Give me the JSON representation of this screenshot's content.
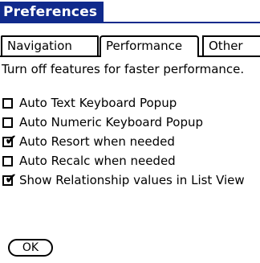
{
  "window": {
    "title": "Preferences"
  },
  "tabs": [
    {
      "label": "Navigation",
      "active": false
    },
    {
      "label": "Performance",
      "active": true
    },
    {
      "label": "Other",
      "active": false
    }
  ],
  "description": "Turn off features for faster performance.",
  "options": [
    {
      "label": "Auto Text  Keyboard Popup",
      "checked": false
    },
    {
      "label": "Auto Numeric Keyboard Popup",
      "checked": false
    },
    {
      "label": "Auto Resort when needed",
      "checked": true
    },
    {
      "label": "Auto Recalc when needed",
      "checked": false
    },
    {
      "label": "Show Relationship values in List View",
      "checked": true
    }
  ],
  "buttons": {
    "ok_label": "OK"
  },
  "colors": {
    "title_bg": "#102a8c",
    "text": "#000000",
    "background": "#ffffff"
  }
}
